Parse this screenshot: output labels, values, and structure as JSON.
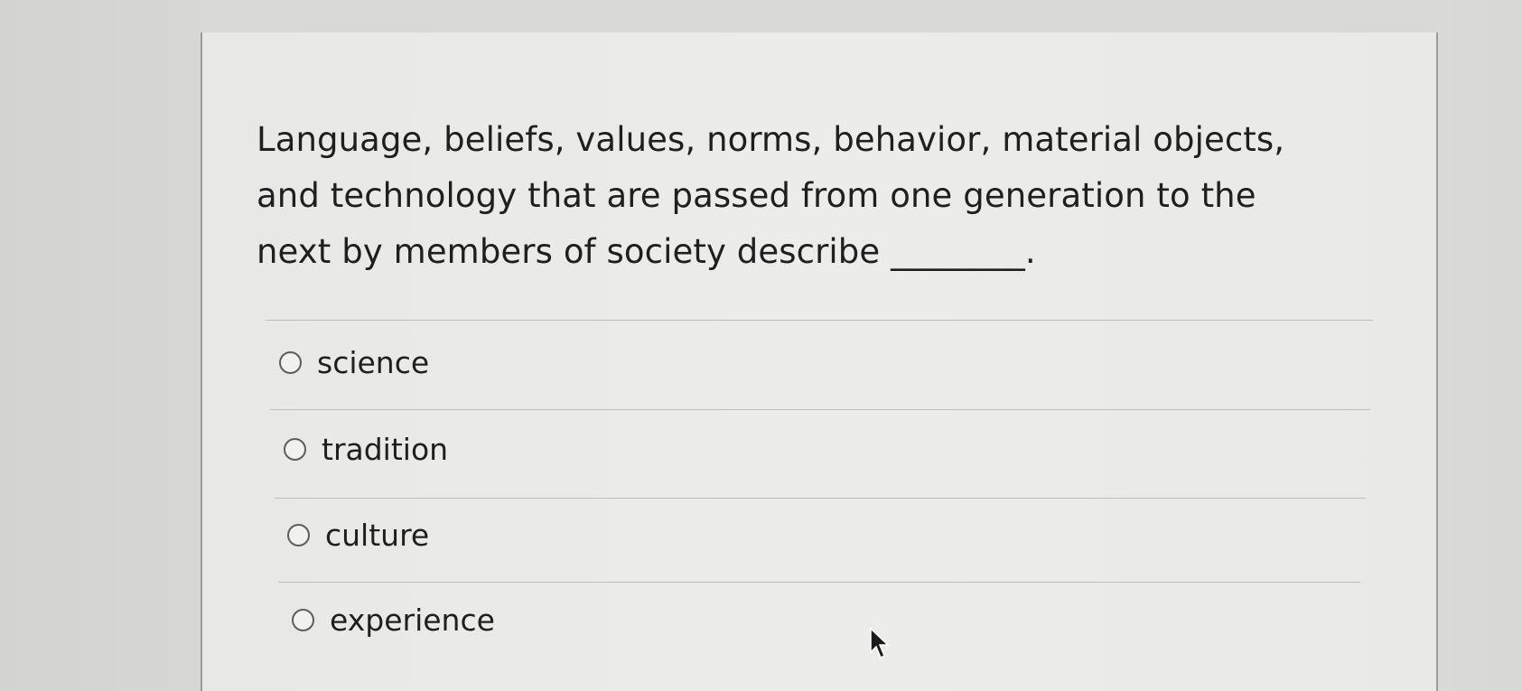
{
  "question": {
    "text": "Language, beliefs, values, norms, behavior, material objects, and technology that are passed from one generation to the next by members of society describe ________."
  },
  "options": [
    {
      "label": "science"
    },
    {
      "label": "tradition"
    },
    {
      "label": "culture"
    },
    {
      "label": "experience"
    }
  ],
  "icons": {
    "radio": "radio-unselected-icon",
    "pointer": "mouse-pointer-icon"
  }
}
